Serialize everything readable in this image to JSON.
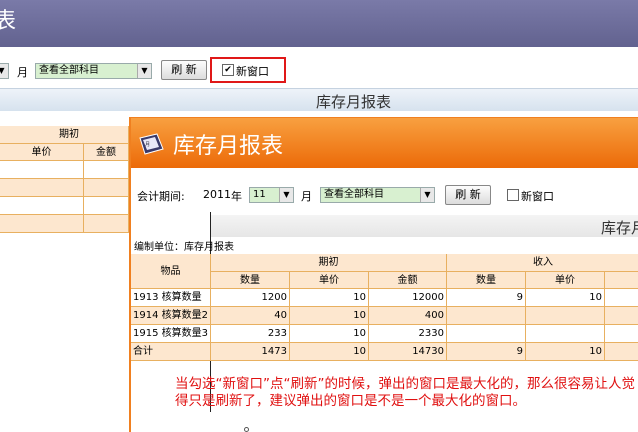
{
  "background": {
    "title_fragment": "表",
    "toolbar": {
      "month_suffix": "月",
      "month_value": "",
      "subject_select": "查看全部科目",
      "refresh_label": "刷 新",
      "new_window_label": "新窗口",
      "new_window_checked": "✔"
    },
    "heading": "库存月报表",
    "table": {
      "group_header": "期初",
      "col_unit_price": "单价",
      "col_amount": "金额"
    }
  },
  "popup": {
    "title": "库存月报表",
    "icon": "report-book-icon",
    "toolbar": {
      "period_label": "会计期间:",
      "year_value": "2011",
      "year_suffix": "年",
      "month_value": "11",
      "month_suffix": "月",
      "subject_select": "查看全部科目",
      "refresh_label": "刷 新",
      "new_window_label": "新窗口"
    },
    "heading": "库存月",
    "unit_label": "编制单位：库存月报表",
    "table": {
      "item_header": "物品",
      "groups": [
        "期初",
        "收入"
      ],
      "columns": [
        "数量",
        "单价",
        "金额",
        "数量",
        "单价"
      ],
      "rows": [
        {
          "item": "1913 核算数量",
          "qty": "1200",
          "price": "10",
          "amount": "12000",
          "in_qty": "9",
          "in_price": "10"
        },
        {
          "item": "1914 核算数量2",
          "qty": "40",
          "price": "10",
          "amount": "400",
          "in_qty": "",
          "in_price": ""
        },
        {
          "item": "1915 核算数量3",
          "qty": "233",
          "price": "10",
          "amount": "2330",
          "in_qty": "",
          "in_price": ""
        },
        {
          "item": "合计",
          "qty": "1473",
          "price": "10",
          "amount": "14730",
          "in_qty": "9",
          "in_price": "10"
        }
      ]
    }
  },
  "annotation": "当勾选“新窗口”点“刷新”的时候，弹出的窗口是最大化的，那么很容易让人觉得只是刷新了，建议弹出的窗口是不是一个最大化的窗口。",
  "colors": {
    "popup_title": "#ec6a08",
    "annotation": "#e01010",
    "highlight_box": "#e01818"
  }
}
